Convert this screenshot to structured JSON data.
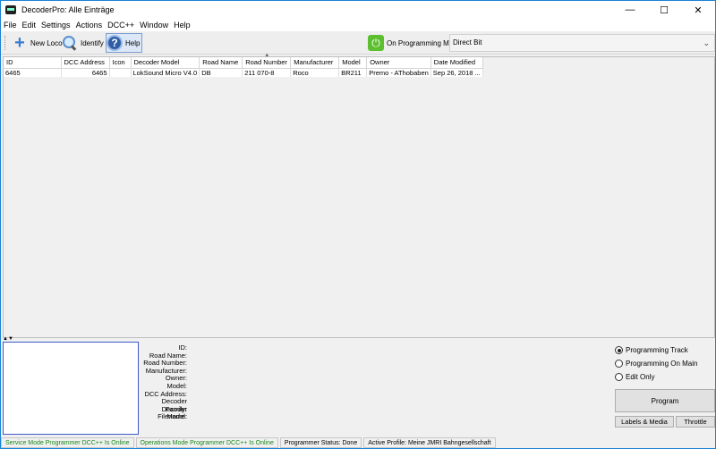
{
  "window": {
    "title": "DecoderPro: Alle Einträge",
    "minimize": "—",
    "maximize": "☐",
    "close": "✕"
  },
  "menu": [
    "File",
    "Edit",
    "Settings",
    "Actions",
    "DCC++",
    "Window",
    "Help"
  ],
  "toolbar": {
    "new_loco": "New Loco",
    "identify": "Identify",
    "help": "Help",
    "power_label": "On Programming Mode",
    "mode_value": "Direct Bit"
  },
  "table": {
    "columns": [
      "ID",
      "DCC Address",
      "Icon",
      "Decoder Model",
      "Road Name",
      "Road Number",
      "Manufacturer",
      "Model",
      "Owner",
      "Date Modified"
    ],
    "rows": [
      [
        "6465",
        "6465",
        "",
        "LokSound Micro V4.0",
        "DB",
        "211 070-8",
        "Roco",
        "BR211",
        "Premo - AThobaben",
        "Sep 26, 2018 ..."
      ]
    ]
  },
  "details": {
    "labels": [
      "ID:",
      "Road Name:",
      "Road Number:",
      "Manufacturer:",
      "Owner:",
      "Model:",
      "DCC Address:",
      "Decoder Family:",
      "Decoder Model:",
      "Filename:"
    ]
  },
  "programming": {
    "options": [
      "Programming Track",
      "Programming On Main",
      "Edit Only"
    ],
    "selected": 0,
    "program_button": "Program",
    "labels_media_button": "Labels & Media",
    "throttle_button": "Throttle"
  },
  "status": {
    "service_mode": "Service Mode Programmer DCC++ Is Online",
    "ops_mode": "Operations Mode Programmer DCC++ Is Online",
    "programmer_status": "Programmer Status:  Done",
    "active_profile": "Active Profile: Meine JMRI Bahngesellschaft"
  },
  "colors": {
    "accent": "#1883d7",
    "status_online": "#1b8a1b",
    "power_on": "#5bbf2f"
  }
}
